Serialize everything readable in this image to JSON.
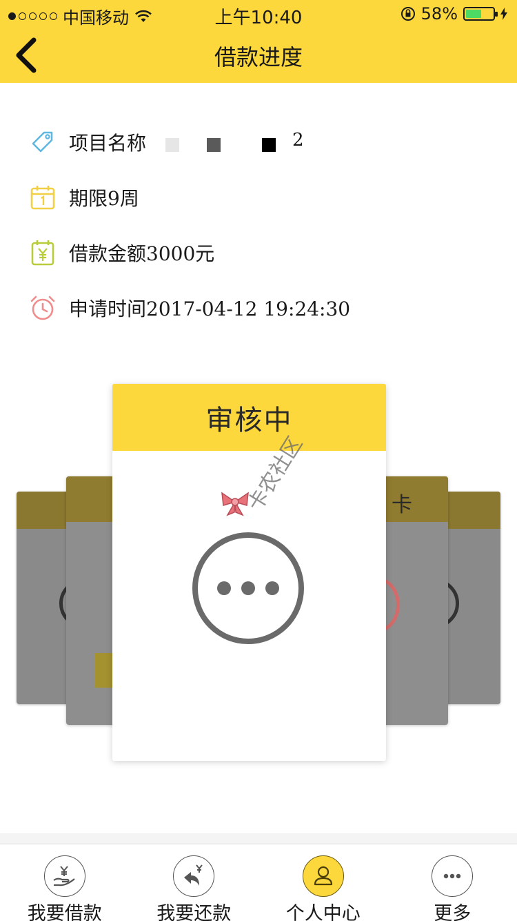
{
  "status_bar": {
    "carrier": "中国移动",
    "time": "上午10:40",
    "battery_percent": "58%",
    "battery_level": 0.58
  },
  "nav": {
    "title": "借款进度",
    "back_icon": "chevron-left-icon"
  },
  "loan_info": {
    "project_name": "项目名称",
    "project_name_suffix": "2",
    "term": "期限9周",
    "amount": "借款金额3000元",
    "apply_time": "申请时间2017-04-12 19:24:30"
  },
  "progress_cards": {
    "current_status": "审核中",
    "right_card_partial": "卡",
    "status_icon": "ellipsis-circle-icon"
  },
  "watermark": {
    "text": "卡农社区"
  },
  "tab_bar": {
    "items": [
      {
        "label": "我要借款",
        "icon": "borrow-yen-hand-icon",
        "active": false
      },
      {
        "label": "我要还款",
        "icon": "repay-yen-arrow-icon",
        "active": false
      },
      {
        "label": "个人中心",
        "icon": "user-icon",
        "active": true
      },
      {
        "label": "更多",
        "icon": "more-dots-icon",
        "active": false
      }
    ]
  },
  "colors": {
    "brand_yellow": "#fdd83c",
    "tag_icon": "#5fb8e0",
    "calendar_icon": "#f2d046",
    "yen_icon": "#b9cc3c",
    "clock_icon": "#ef8d8d"
  }
}
